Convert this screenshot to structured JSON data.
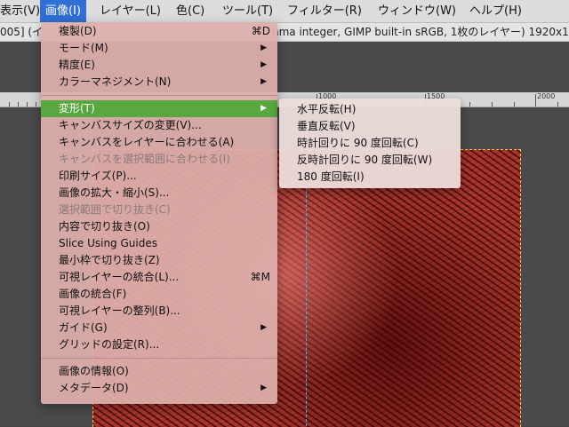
{
  "menubar": {
    "items": [
      {
        "label": "表示(V)"
      },
      {
        "label": "画像(I)"
      },
      {
        "label": "レイヤー(L)"
      },
      {
        "label": "色(C)"
      },
      {
        "label": "ツール(T)"
      },
      {
        "label": "フィルター(R)"
      },
      {
        "label": "ウィンドウ(W)"
      },
      {
        "label": "ヘルプ(H)"
      }
    ]
  },
  "title": {
    "left": "005] (イ",
    "right": "nma integer, GIMP built-in sRGB, 1枚のレイヤー) 1920x1"
  },
  "ruler": {
    "labels": [
      "1000",
      "1500",
      "2000"
    ]
  },
  "image_menu": {
    "items": [
      {
        "label": "複製(D)",
        "shortcut": "⌘D"
      },
      {
        "label": "モード(M)"
      },
      {
        "label": "精度(E)"
      },
      {
        "label": "カラーマネジメント(N)"
      },
      {
        "label": "変形(T)"
      },
      {
        "label": "キャンバスサイズの変更(V)..."
      },
      {
        "label": "キャンバスをレイヤーに合わせる(A)"
      },
      {
        "label": "キャンバスを選択範囲に合わせる(I)"
      },
      {
        "label": "印刷サイズ(P)..."
      },
      {
        "label": "画像の拡大・縮小(S)..."
      },
      {
        "label": "選択範囲で切り抜き(C)"
      },
      {
        "label": "内容で切り抜き(O)"
      },
      {
        "label": "Slice Using Guides"
      },
      {
        "label": "最小枠で切り抜き(Z)"
      },
      {
        "label": "可視レイヤーの統合(L)...",
        "shortcut": "⌘M"
      },
      {
        "label": "画像の統合(F)"
      },
      {
        "label": "可視レイヤーの整列(B)..."
      },
      {
        "label": "ガイド(G)"
      },
      {
        "label": "グリッドの設定(R)..."
      },
      {
        "label": "画像の情報(O)"
      },
      {
        "label": "メタデータ(D)"
      }
    ]
  },
  "transform_submenu": {
    "items": [
      {
        "label": "水平反転(H)"
      },
      {
        "label": "垂直反転(V)"
      },
      {
        "label": "時計回りに 90 度回転(C)"
      },
      {
        "label": "反時計回りに 90 度回転(W)"
      },
      {
        "label": "180 度回転(I)"
      }
    ]
  },
  "colors": {
    "highlight": "#58a83f",
    "active_menu": "#2f6fd6",
    "selection_border": "#e8d43a",
    "guide": "#39b6ff"
  }
}
